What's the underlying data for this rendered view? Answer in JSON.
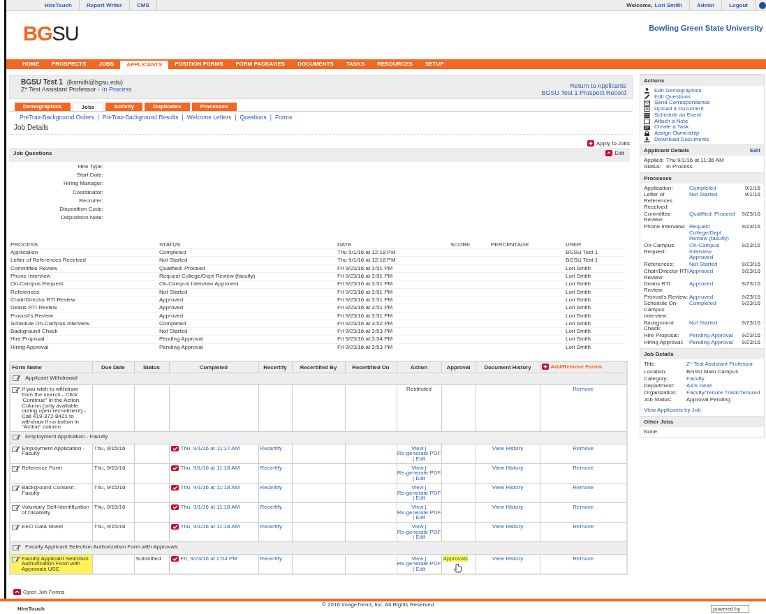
{
  "top_links": [
    "HireTouch",
    "Report Writer",
    "CMS"
  ],
  "user_bar": {
    "welcome": "Welcome,",
    "user": "Lori Smith",
    "links": [
      "Admin",
      "Logout"
    ]
  },
  "logo": {
    "accent": "BG",
    "rest": "SU"
  },
  "university": "Bowling Green State University",
  "nav": [
    {
      "label": "HOME",
      "selected": false
    },
    {
      "label": "PROSPECTS",
      "selected": false
    },
    {
      "label": "JOBS",
      "selected": false
    },
    {
      "label": "APPLICANTS",
      "selected": true
    },
    {
      "label": "POSITION FORMS",
      "selected": false
    },
    {
      "label": "FORM PACKAGES",
      "selected": false
    },
    {
      "label": "DOCUMENTS",
      "selected": false
    },
    {
      "label": "TASKS",
      "selected": false
    },
    {
      "label": "RESOURCES",
      "selected": false
    },
    {
      "label": "SETUP",
      "selected": false
    }
  ],
  "applicant": {
    "name": "BGSU Test 1",
    "email": "(lksmith@bgsu.edu)",
    "job": "Z* Test Assistant Professor -",
    "status": "In Process",
    "links": [
      "Return to Applicants",
      "BGSU Test 1 Prospect Record"
    ]
  },
  "subtabs": [
    {
      "label": "Demographics",
      "selected": false
    },
    {
      "label": "Jobs",
      "selected": true
    },
    {
      "label": "Activity",
      "selected": false
    },
    {
      "label": "Duplicates",
      "selected": false
    },
    {
      "label": "Processes",
      "selected": false
    }
  ],
  "sublink_separator": "|",
  "sublinks": [
    "PreTrax-Background Orders",
    "PreTrax-Background Results",
    "Welcome Letters",
    "Questions",
    "Forms"
  ],
  "section_title": "Job Details",
  "apply_link": "Apply to Jobs",
  "job_questions": {
    "title": "Job Questions",
    "edit": "Edit",
    "fields": [
      "Hire Type:",
      "Start Date:",
      "Hiring Manager:",
      "Coordinator:",
      "Recruiter:",
      "Disposition Code:",
      "Disposition Note:"
    ]
  },
  "process_table": {
    "columns": [
      "PROCESS",
      "STATUS",
      "DATE",
      "SCORE",
      "PERCENTAGE",
      "USER"
    ],
    "rows": [
      [
        "Application",
        "Completed",
        "Thu 9/1/16 at 12:18 PM",
        "",
        "",
        "BGSU Test 1"
      ],
      [
        "Letter of References Received",
        "Not Started",
        "Thu 9/1/16 at 12:18 PM",
        "",
        "",
        "BGSU Test 1"
      ],
      [
        "Committee Review",
        "Qualified: Proceed",
        "Fri 9/23/16 at 3:51 PM",
        "",
        "",
        "Lori Smith"
      ],
      [
        "Phone Interview",
        "Request College/Dept Review (faculty)",
        "Fri 9/23/16 at 3:51 PM",
        "",
        "",
        "Lori Smith"
      ],
      [
        "On-Campus Request",
        "On-Campus Interview Approved",
        "Fri 9/23/16 at 3:51 PM",
        "",
        "",
        "Lori Smith"
      ],
      [
        "References",
        "Not Started",
        "Fri 9/23/16 at 3:51 PM",
        "",
        "",
        "Lori Smith"
      ],
      [
        "Chair/Director RTI Review",
        "Approved",
        "Fri 9/23/16 at 3:51 PM",
        "",
        "",
        "Lori Smith"
      ],
      [
        "Deans RTI Review",
        "Approved",
        "Fri 9/23/16 at 3:51 PM",
        "",
        "",
        "Lori Smith"
      ],
      [
        "Provost's Review",
        "Approved",
        "Fri 9/23/16 at 3:51 PM",
        "",
        "",
        "Lori Smith"
      ],
      [
        "Schedule On-Campus Interview",
        "Completed",
        "Fri 9/23/16 at 3:52 PM",
        "",
        "",
        "Lori Smith"
      ],
      [
        "Background Check",
        "Not Started",
        "Fri 9/23/16 at 3:53 PM",
        "",
        "",
        "Lori Smith"
      ],
      [
        "Hire Proposal",
        "Pending Approval",
        "Fri 9/23/16 at 3:54 PM",
        "",
        "",
        "Lori Smith"
      ],
      [
        "Hiring Approval",
        "Pending Approval",
        "Fri 9/23/16 at 3:53 PM",
        "",
        "",
        "Lori Smith"
      ]
    ]
  },
  "forms_table": {
    "columns": [
      "Form Name",
      "Due Date",
      "Status",
      "Completed",
      "Recertify",
      "Recertified By",
      "Recertified On",
      "Action",
      "Approval",
      "Document History"
    ],
    "add_remove": "Add/Remove Forms",
    "action_separator": "|",
    "groups": [
      {
        "title": "Applicant Withdrawal",
        "forms": [
          {
            "name": "If you wish to withdraw from the search - Click 'Continue\" in the Action Column (only available during open recruitment) - Call 419-372-8421 to withdraw if no button in \"Action\" column",
            "highlighted": false,
            "action": {
              "kind": "text",
              "text": "Restricted"
            },
            "remove": "Remove"
          }
        ]
      },
      {
        "title": "Employment Application - Faculty",
        "forms": [
          {
            "name": "Employment Application - Faculty",
            "highlighted": false,
            "due": "Thu, 9/15/16",
            "completed": "Thu, 9/1/16 at 11:17 AM",
            "recertify": "Recertify",
            "action": {
              "kind": "links",
              "links": [
                "View",
                "Re-generate PDF",
                "Edit"
              ]
            },
            "history": "View History",
            "remove": "Remove"
          },
          {
            "name": "Reference Form",
            "highlighted": false,
            "due": "Thu, 9/15/16",
            "completed": "Thu, 9/1/16 at 11:18 AM",
            "recertify": "Recertify",
            "action": {
              "kind": "links",
              "links": [
                "View",
                "Re-generate PDF",
                "Edit"
              ]
            },
            "history": "View History",
            "remove": "Remove"
          },
          {
            "name": "Background Consent - Faculty",
            "highlighted": false,
            "due": "Thu, 9/15/16",
            "completed": "Thu, 9/1/16 at 11:18 AM",
            "recertify": "Recertify",
            "action": {
              "kind": "links",
              "links": [
                "View",
                "Re-generate PDF",
                "Edit"
              ]
            },
            "history": "View History",
            "remove": "Remove"
          },
          {
            "name": "Voluntary Self-Identification of Disability",
            "highlighted": false,
            "due": "Thu, 9/15/16",
            "completed": "Thu, 9/1/16 at 11:18 AM",
            "recertify": "Recertify",
            "action": {
              "kind": "links",
              "links": [
                "View",
                "Re-generate PDF",
                "Edit"
              ]
            },
            "history": "View History",
            "remove": "Remove"
          },
          {
            "name": "EEO Data Sheet",
            "highlighted": false,
            "due": "Thu, 9/15/16",
            "completed": "Thu, 9/1/16 at 11:18 AM",
            "recertify": "Recertify",
            "action": {
              "kind": "links",
              "links": [
                "View",
                "Re-generate PDF",
                "Edit"
              ]
            },
            "history": "View History",
            "remove": "Remove"
          }
        ]
      },
      {
        "title": "Faculty Applicant Selection Authorization Form with Approvals",
        "forms": [
          {
            "name": "Faculty Applicant Selection Authorization Form with Approvals USE",
            "highlighted": true,
            "status": "Submitted",
            "completed": "Fri, 9/23/16 at 2:54 PM",
            "recertify": "Recertify",
            "action": {
              "kind": "links",
              "links": [
                "View",
                "Re-generate PDF",
                "Edit"
              ]
            },
            "approval": {
              "text": "Approvals",
              "highlighted": true
            },
            "history": "View History",
            "remove": "Remove"
          }
        ]
      }
    ]
  },
  "open_job_forms": "Open Job Forms",
  "sidebar": {
    "actions": {
      "title": "Actions",
      "items": [
        {
          "label": "Edit Demographics",
          "kind": "person"
        },
        {
          "label": "Edit Questions",
          "kind": "pencil"
        },
        {
          "label": "Send Correspondence",
          "kind": "envelope"
        },
        {
          "label": "Upload a Document",
          "kind": "document"
        },
        {
          "label": "Schedule an Event",
          "kind": "calendar"
        },
        {
          "label": "Attach a Note",
          "kind": "note"
        },
        {
          "label": "Create a Task",
          "kind": "task"
        },
        {
          "label": "Assign Ownership",
          "kind": "lock"
        },
        {
          "label": "Download Documents",
          "kind": "download"
        }
      ]
    },
    "applicant_details": {
      "title": "Applicant Details",
      "edit": "Edit",
      "rows": [
        {
          "label": "Applied:",
          "value": "Thu 9/1/16 at 11:36 AM"
        },
        {
          "label": "Status:",
          "value": "In Process"
        }
      ]
    },
    "processes": {
      "title": "Processes",
      "rows": [
        {
          "label": "Application:",
          "value": "Completed",
          "date": "9/1/16"
        },
        {
          "label": "Letter of References Received:",
          "value": "Not Started",
          "date": "9/1/16"
        },
        {
          "label": "Committee Review:",
          "value": "Qualified: Proceed",
          "date": "9/23/16"
        },
        {
          "label": "Phone Interview:",
          "value": "Request College/Dept Review (faculty)",
          "date": "9/23/16"
        },
        {
          "label": "On-Campus Request:",
          "value": "On-Campus Interview Approved",
          "date": "9/23/16"
        },
        {
          "label": "References:",
          "value": "Not Started",
          "date": "9/23/16"
        },
        {
          "label": "Chair/Director RTI Review:",
          "value": "Approved",
          "date": "9/23/16"
        },
        {
          "label": "Deans RTI Review:",
          "value": "Approved",
          "date": "9/23/16"
        },
        {
          "label": "Provost's Review:",
          "value": "Approved",
          "date": "9/23/16"
        },
        {
          "label": "Schedule On-Campus Interview:",
          "value": "Completed",
          "date": "9/23/16"
        },
        {
          "label": "Background Check:",
          "value": "Not Started",
          "date": "9/23/16"
        },
        {
          "label": "Hire Proposal:",
          "value": "Pending Approval",
          "date": "9/23/16"
        },
        {
          "label": "Hiring Approval:",
          "value": "Pending Approval",
          "date": "9/23/16"
        }
      ]
    },
    "job_details": {
      "title": "Job Details",
      "rows": [
        {
          "label": "Title:",
          "value": "Z* Test Assistant Professor",
          "link": true
        },
        {
          "label": "Location:",
          "value": "BGSU Main Campus",
          "link": false
        },
        {
          "label": "Category:",
          "value": "Faculty",
          "link": true
        },
        {
          "label": "Department:",
          "value": "A&S Dean",
          "link": true
        },
        {
          "label": "Organization:",
          "value": "Faculty/Tenure Track/Tenured",
          "link": true
        },
        {
          "label": "Job Status:",
          "value": "Approval Pending",
          "link": false
        }
      ],
      "link": "View Applicants by Job"
    },
    "other_jobs": {
      "title": "Other Jobs",
      "value": "None"
    }
  },
  "footer": {
    "logo": "HireTouch",
    "copyright": "© 2016 ImageTrend, Inc. All Rights Reserved",
    "powered": "powered by"
  }
}
